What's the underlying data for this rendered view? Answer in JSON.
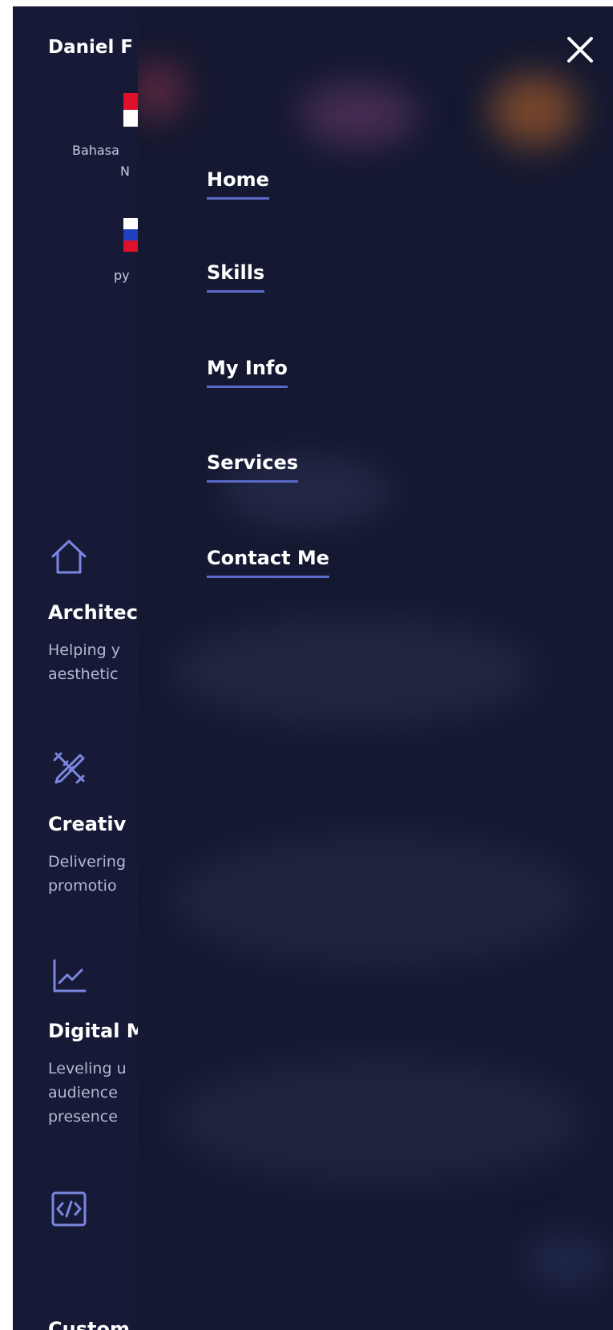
{
  "header": {
    "site_name_visible": "Daniel F"
  },
  "languages": [
    {
      "label_line1": "Bahasa",
      "label_line2": "N",
      "flag": "indonesia-flag"
    },
    {
      "label": "ру",
      "flag": "russia-flag"
    }
  ],
  "services": [
    {
      "icon": "home-icon",
      "title": "Architec",
      "desc": "Helping y\naesthetic"
    },
    {
      "icon": "ruler-pencil-icon",
      "title": "Creativ",
      "desc": "Delivering\npromotio"
    },
    {
      "icon": "line-chart-icon",
      "title": "Digital M",
      "desc": "Leveling u\naudience\npresence"
    },
    {
      "icon": "code-icon",
      "title": "Custom",
      "desc": ""
    }
  ],
  "menu": {
    "close_icon": "close-icon",
    "items": [
      {
        "label": "Home"
      },
      {
        "label": "Skills"
      },
      {
        "label": "My Info"
      },
      {
        "label": "Services"
      },
      {
        "label": "Contact Me"
      }
    ]
  },
  "colors": {
    "background": "#161a36",
    "overlay": "#141830",
    "accent_underline": "#5b69c9",
    "icon_color": "#7b86e0"
  }
}
